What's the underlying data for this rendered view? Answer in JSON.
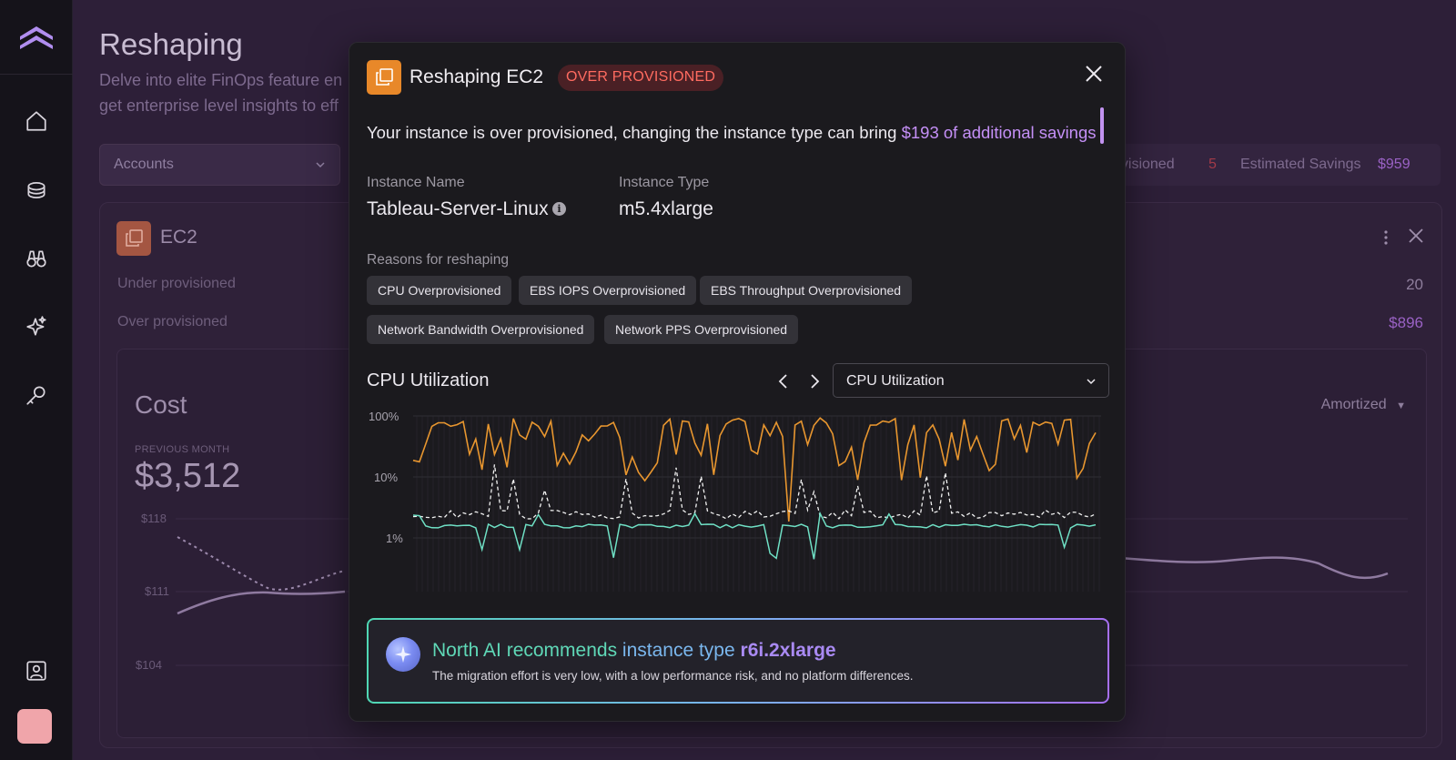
{
  "sidebar": {
    "items": [
      {
        "name": "home-icon"
      },
      {
        "name": "coins-icon"
      },
      {
        "name": "binoculars-icon"
      },
      {
        "name": "sparkle-icon"
      },
      {
        "name": "key-icon"
      }
    ],
    "bottom": [
      {
        "name": "user-contact-icon"
      },
      {
        "name": "avatar"
      }
    ],
    "avatar_color": "#f0a5aa"
  },
  "page": {
    "title": "Reshaping",
    "description": "Delve into elite FinOps feature en get enterprise level insights to eff",
    "accounts_label": "Accounts",
    "stats": {
      "provisioned_label": "ovisioned",
      "provisioned_count": "5",
      "savings_label": "Estimated Savings",
      "savings_value": "$959"
    },
    "ec2_card": {
      "title": "EC2",
      "under_label": "Under provisioned",
      "under_value": "20",
      "over_label": "Over provisioned",
      "over_value": "$896",
      "cost": {
        "title": "Cost",
        "previous_label": "PREVIOUS MONTH",
        "previous_value": "$3,512",
        "mode": "Amortized",
        "y_ticks": [
          "$118",
          "$111",
          "$104"
        ]
      }
    }
  },
  "modal": {
    "title": "Reshaping EC2",
    "badge": "OVER PROVISIONED",
    "summary_prefix": "Your instance is over provisioned, changing the instance type can bring ",
    "summary_highlight": "$193 of additional savings",
    "instance_name_label": "Instance Name",
    "instance_name": "Tableau-Server-Linux",
    "instance_type_label": "Instance Type",
    "instance_type": "m5.4xlarge",
    "reasons_label": "Reasons for reshaping",
    "reasons": [
      "CPU Overprovisioned",
      "EBS IOPS Overprovisioned",
      "EBS Throughput Overprovisioned",
      "Network Bandwidth Overprovisioned",
      "Network PPS Overprovisioned"
    ],
    "chart_title": "CPU Utilization",
    "metric_selected": "CPU Utilization",
    "y_ticks": [
      "100%",
      "10%",
      "1%"
    ],
    "recommendation": {
      "prefix": "North AI recommends ",
      "middle": "instance type ",
      "instance": "r6i.2xlarge",
      "detail": "The migration effort is very low, with a low performance risk, and no platform differences."
    }
  },
  "colors": {
    "accent_purple": "#c590f7",
    "badge_red": "#ff6b60",
    "series_max": "#e8962f",
    "series_avg": "#6fe0c5",
    "series_p95": "#ffffff"
  }
}
